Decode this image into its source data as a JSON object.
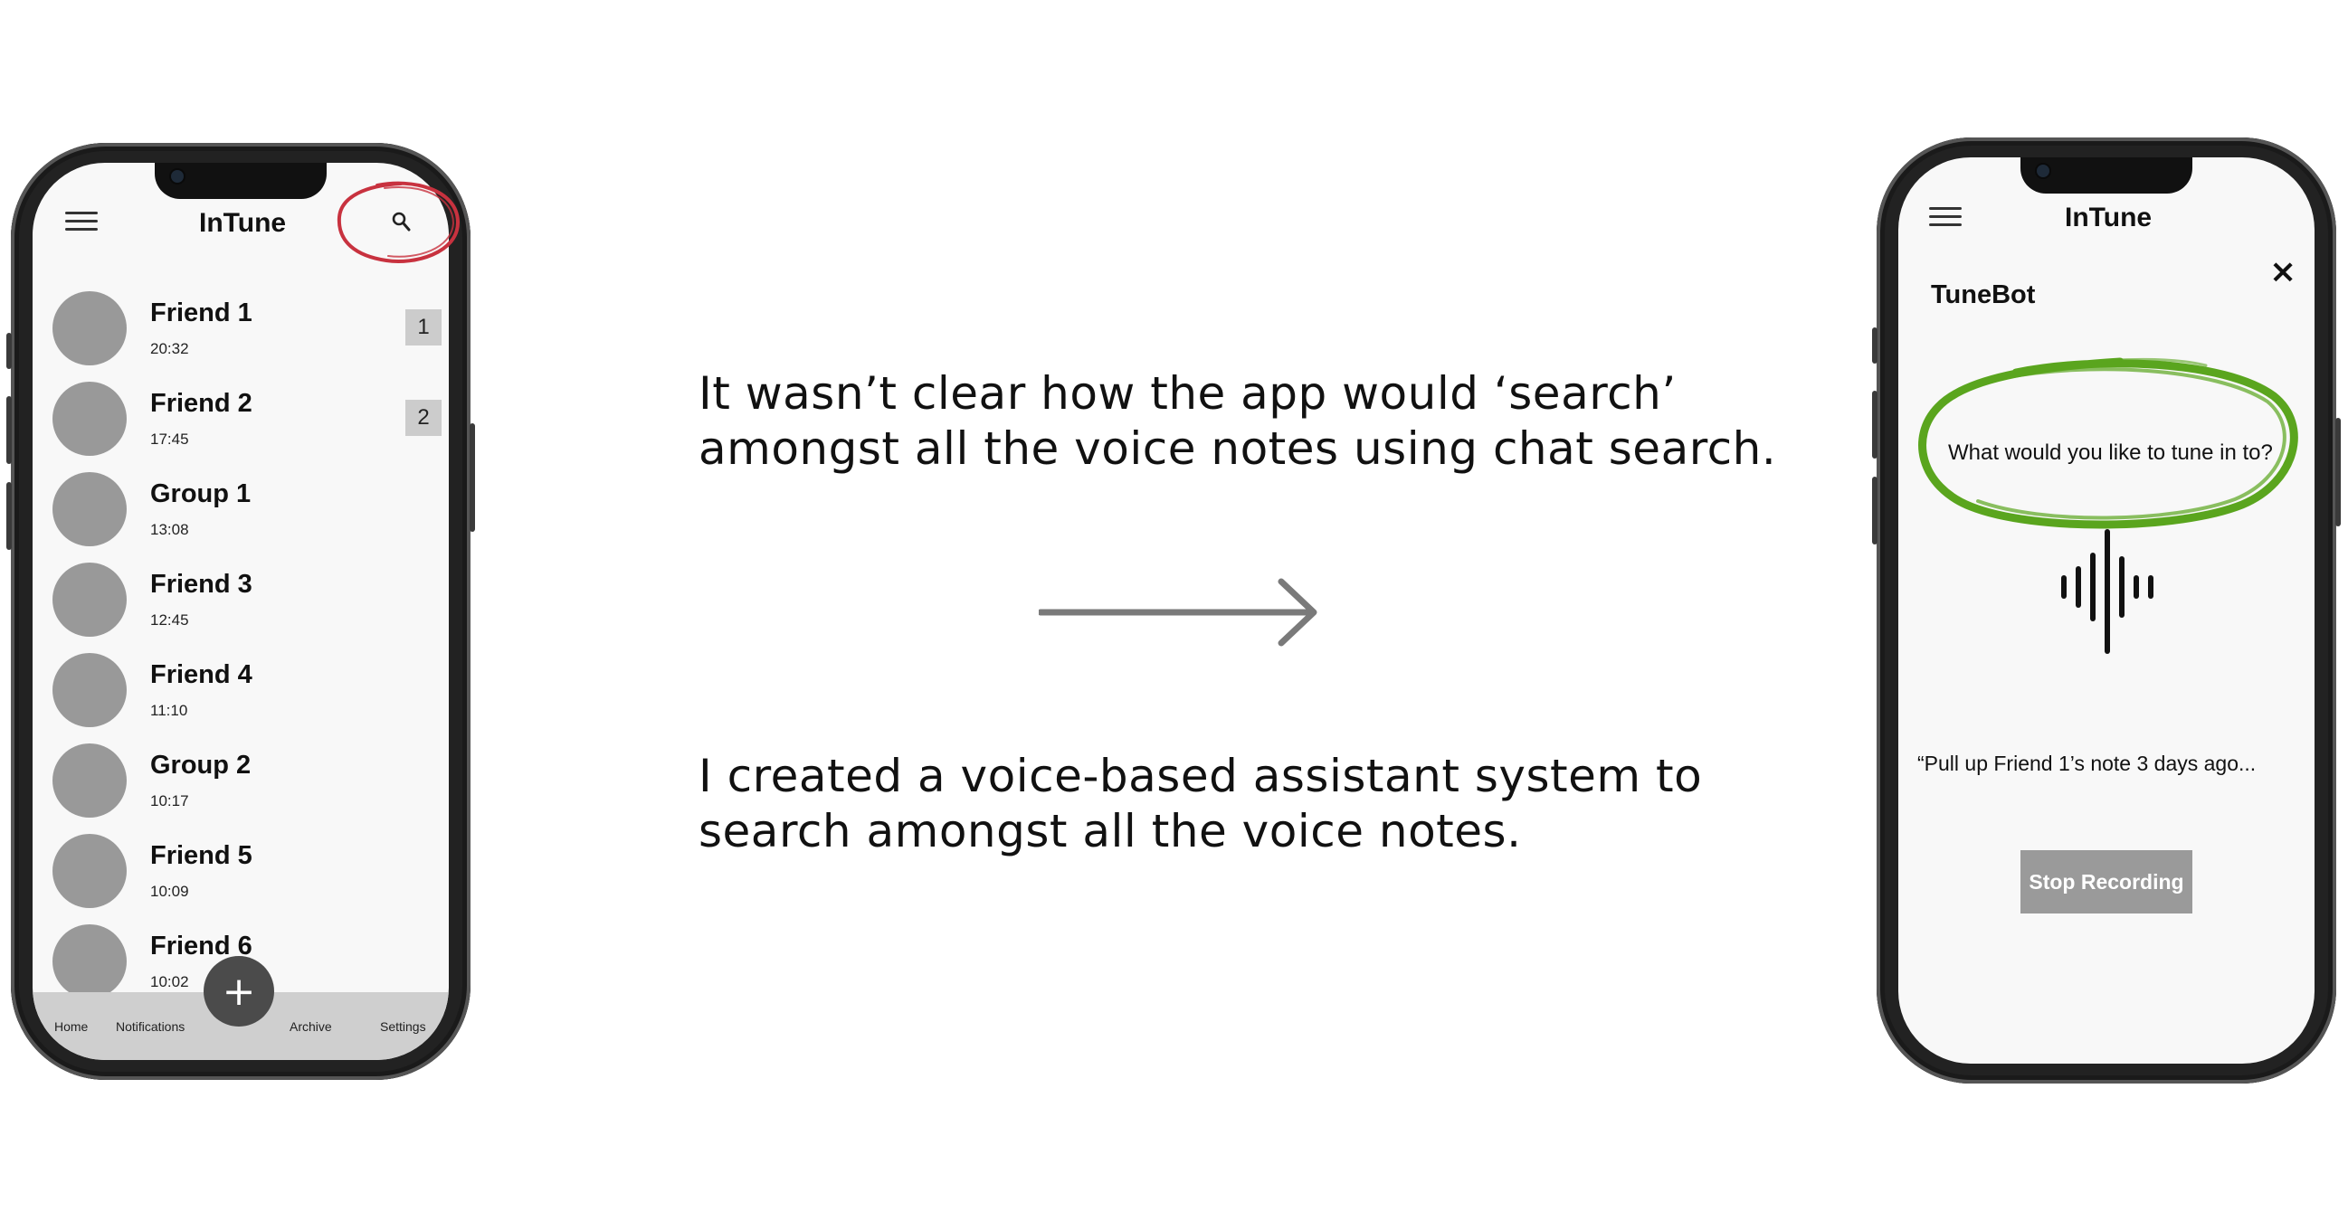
{
  "left_phone": {
    "app_title": "InTune",
    "chats": [
      {
        "name": "Friend 1",
        "time": "20:32",
        "badge": "1"
      },
      {
        "name": "Friend 2",
        "time": "17:45",
        "badge": "2"
      },
      {
        "name": "Group 1",
        "time": "13:08"
      },
      {
        "name": "Friend 3",
        "time": "12:45"
      },
      {
        "name": "Friend 4",
        "time": "11:10"
      },
      {
        "name": "Group 2",
        "time": "10:17"
      },
      {
        "name": "Friend 5",
        "time": "10:09"
      },
      {
        "name": "Friend 6",
        "time": "10:02"
      }
    ],
    "fab_label": "+",
    "nav": {
      "home": "Home",
      "notifications": "Notifications",
      "archive": "Archive",
      "settings": "Settings"
    },
    "highlight_color": "#c8323f"
  },
  "captions": {
    "problem_line1": "It wasn’t clear how the app would ‘search’",
    "problem_line2": "amongst all the voice notes using chat search.",
    "solution_line1": "I created a voice-based assistant system to",
    "solution_line2": "search amongst all the voice notes."
  },
  "right_phone": {
    "app_title": "InTune",
    "panel_title": "TuneBot",
    "close_label": "×",
    "prompt": "What would you like to tune in to?",
    "transcript": "“Pull up Friend 1’s note 3 days ago...",
    "stop_button": "Stop Recording",
    "highlight_color": "#5aa51e"
  }
}
